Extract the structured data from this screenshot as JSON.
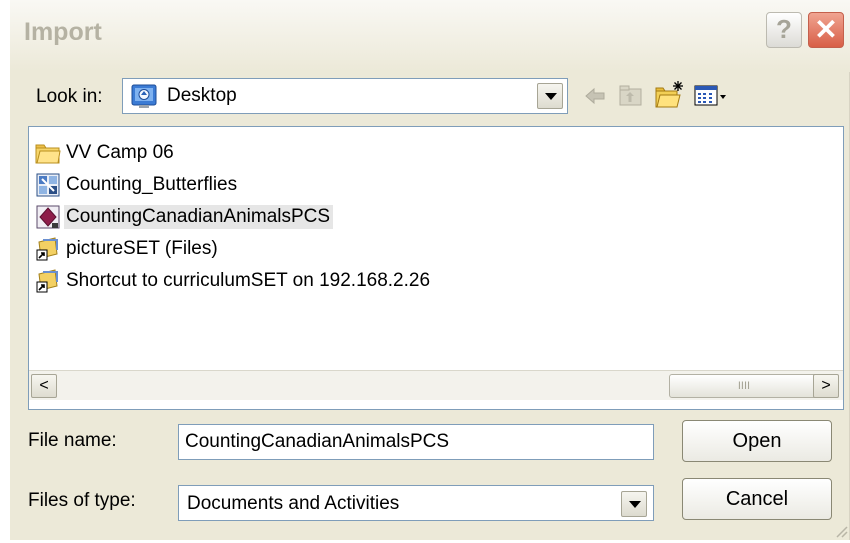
{
  "window": {
    "title": "Import",
    "help_label": "?",
    "close_label": "✕"
  },
  "toolbar": {
    "look_in_label": "Look in:",
    "look_in_value": "Desktop",
    "back_icon": "back-arrow-icon",
    "up_icon": "up-folder-icon",
    "new_folder_icon": "new-folder-icon",
    "view_menu_icon": "view-menu-icon"
  },
  "files": [
    {
      "name": "VV Camp 06",
      "icon": "folder-icon"
    },
    {
      "name": "Counting_Butterflies",
      "icon": "activity-file-icon"
    },
    {
      "name": "CountingCanadianAnimalsPCS",
      "icon": "document-file-icon",
      "selected": true
    },
    {
      "name": "pictureSET (Files)",
      "icon": "shortcut-icon"
    },
    {
      "name": "Shortcut to curriculumSET on 192.168.2.26",
      "icon": "shortcut-icon"
    }
  ],
  "scrollbar": {
    "left_label": "<",
    "right_label": ">",
    "thumb_grip": "IIII"
  },
  "file_name": {
    "label": "File name:",
    "value": "CountingCanadianAnimalsPCS"
  },
  "file_type": {
    "label": "Files of type:",
    "value": "Documents and Activities"
  },
  "buttons": {
    "open": "Open",
    "cancel": "Cancel"
  },
  "colors": {
    "dialog_bg": "#ece9d8",
    "field_border": "#7f9db9",
    "close_red": "#d85f47",
    "selection_bg": "#e6e6e6"
  }
}
